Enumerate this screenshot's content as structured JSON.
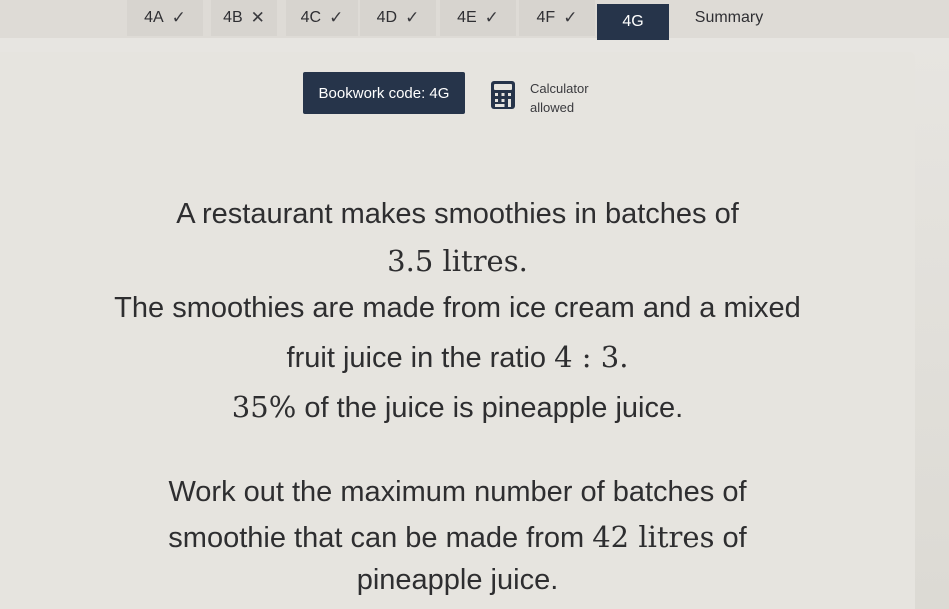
{
  "tabs": [
    {
      "label": "4A",
      "status": "correct"
    },
    {
      "label": "4B",
      "status": "incorrect"
    },
    {
      "label": "4C",
      "status": "correct"
    },
    {
      "label": "4D",
      "status": "correct"
    },
    {
      "label": "4E",
      "status": "correct"
    },
    {
      "label": "4F",
      "status": "correct"
    },
    {
      "label": "4G",
      "status": "active"
    },
    {
      "label": "Summary",
      "status": "none"
    }
  ],
  "marks": {
    "correct": "✓",
    "incorrect": "✕"
  },
  "header": {
    "bookwork_label": "Bookwork code: 4G",
    "calculator_line1": "Calculator",
    "calculator_line2": "allowed",
    "calculator_icon": "calculator-icon"
  },
  "question": {
    "l1": "A restaurant makes smoothies in batches of",
    "l2_value": "3.5 litres.",
    "l3": "The smoothies are made from ice cream and a mixed",
    "l4_text": "fruit juice in the ratio ",
    "l4_ratio": "4 : 3.",
    "l5_percent": "35%",
    "l5_text": " of the juice is pineapple juice.",
    "l6": "Work out the maximum number of batches of",
    "l7_text": "smoothie that can be made from ",
    "l7_value": "42 litres",
    "l7_tail": " of",
    "l8": "pineapple juice."
  },
  "colors": {
    "active_tab": "#26344a",
    "tab_bg": "#d7d4cf",
    "page_bg": "#e6e4df"
  }
}
